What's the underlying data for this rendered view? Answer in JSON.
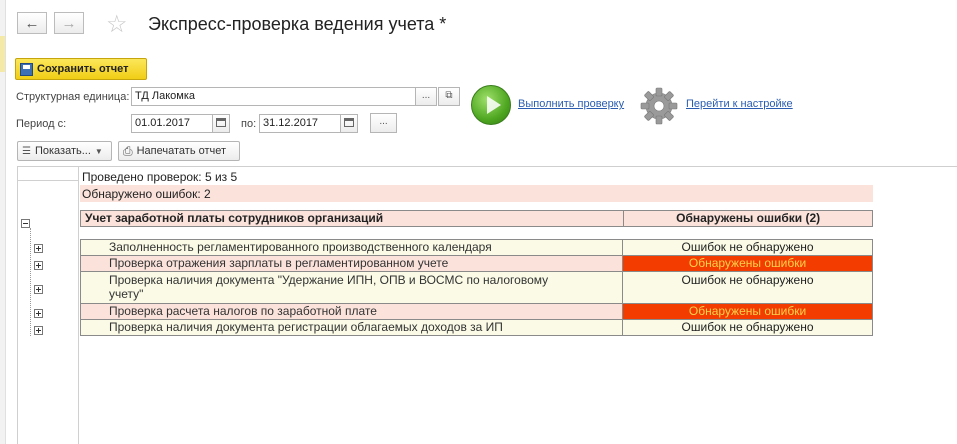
{
  "window": {
    "title": "Экспресс-проверка ведения учета *"
  },
  "toolbar": {
    "save_label": "Сохранить отчет",
    "show_label": "Показать...",
    "print_label": "Напечатать отчет"
  },
  "form": {
    "unit_label": "Структурная единица:",
    "unit_value": "ТД Лакомка",
    "period_label": "Период с:",
    "date_from": "01.01.2017",
    "to_label": "по:",
    "date_to": "31.12.2017",
    "more_btn": "...",
    "open_btn": "⧉"
  },
  "actions": {
    "run_label": "Выполнить проверку",
    "settings_label": "Перейти к настройке"
  },
  "report": {
    "checks_done": "Проведено проверок: 5 из 5",
    "errors_found": "Обнаружено ошибок: 2",
    "group": {
      "name": "Учет заработной платы сотрудников организаций",
      "status": "Обнаружены ошибки (2)"
    },
    "rows": [
      {
        "name": "Заполненность регламентированного производственного календаря",
        "status": "Ошибок не обнаружено",
        "error": false
      },
      {
        "name": "Проверка отражения зарплаты в регламентированном учете",
        "status": "Обнаружены ошибки",
        "error": true
      },
      {
        "name": "Проверка наличия документа \"Удержание ИПН, ОПВ и ВОСМС по налоговому",
        "name2": "учету\"",
        "status": "Ошибок не обнаружено",
        "error": false
      },
      {
        "name": "Проверка расчета налогов по заработной плате",
        "status": "Обнаружены ошибки",
        "error": true
      },
      {
        "name": "Проверка наличия документа регистрации облагаемых доходов за ИП",
        "status": "Ошибок не обнаружено",
        "error": false
      }
    ]
  },
  "colors": {
    "accent_yellow": "#f1cd15",
    "error_bg": "#f23c00",
    "error_text": "#ffd24a",
    "link": "#2a5db0"
  }
}
